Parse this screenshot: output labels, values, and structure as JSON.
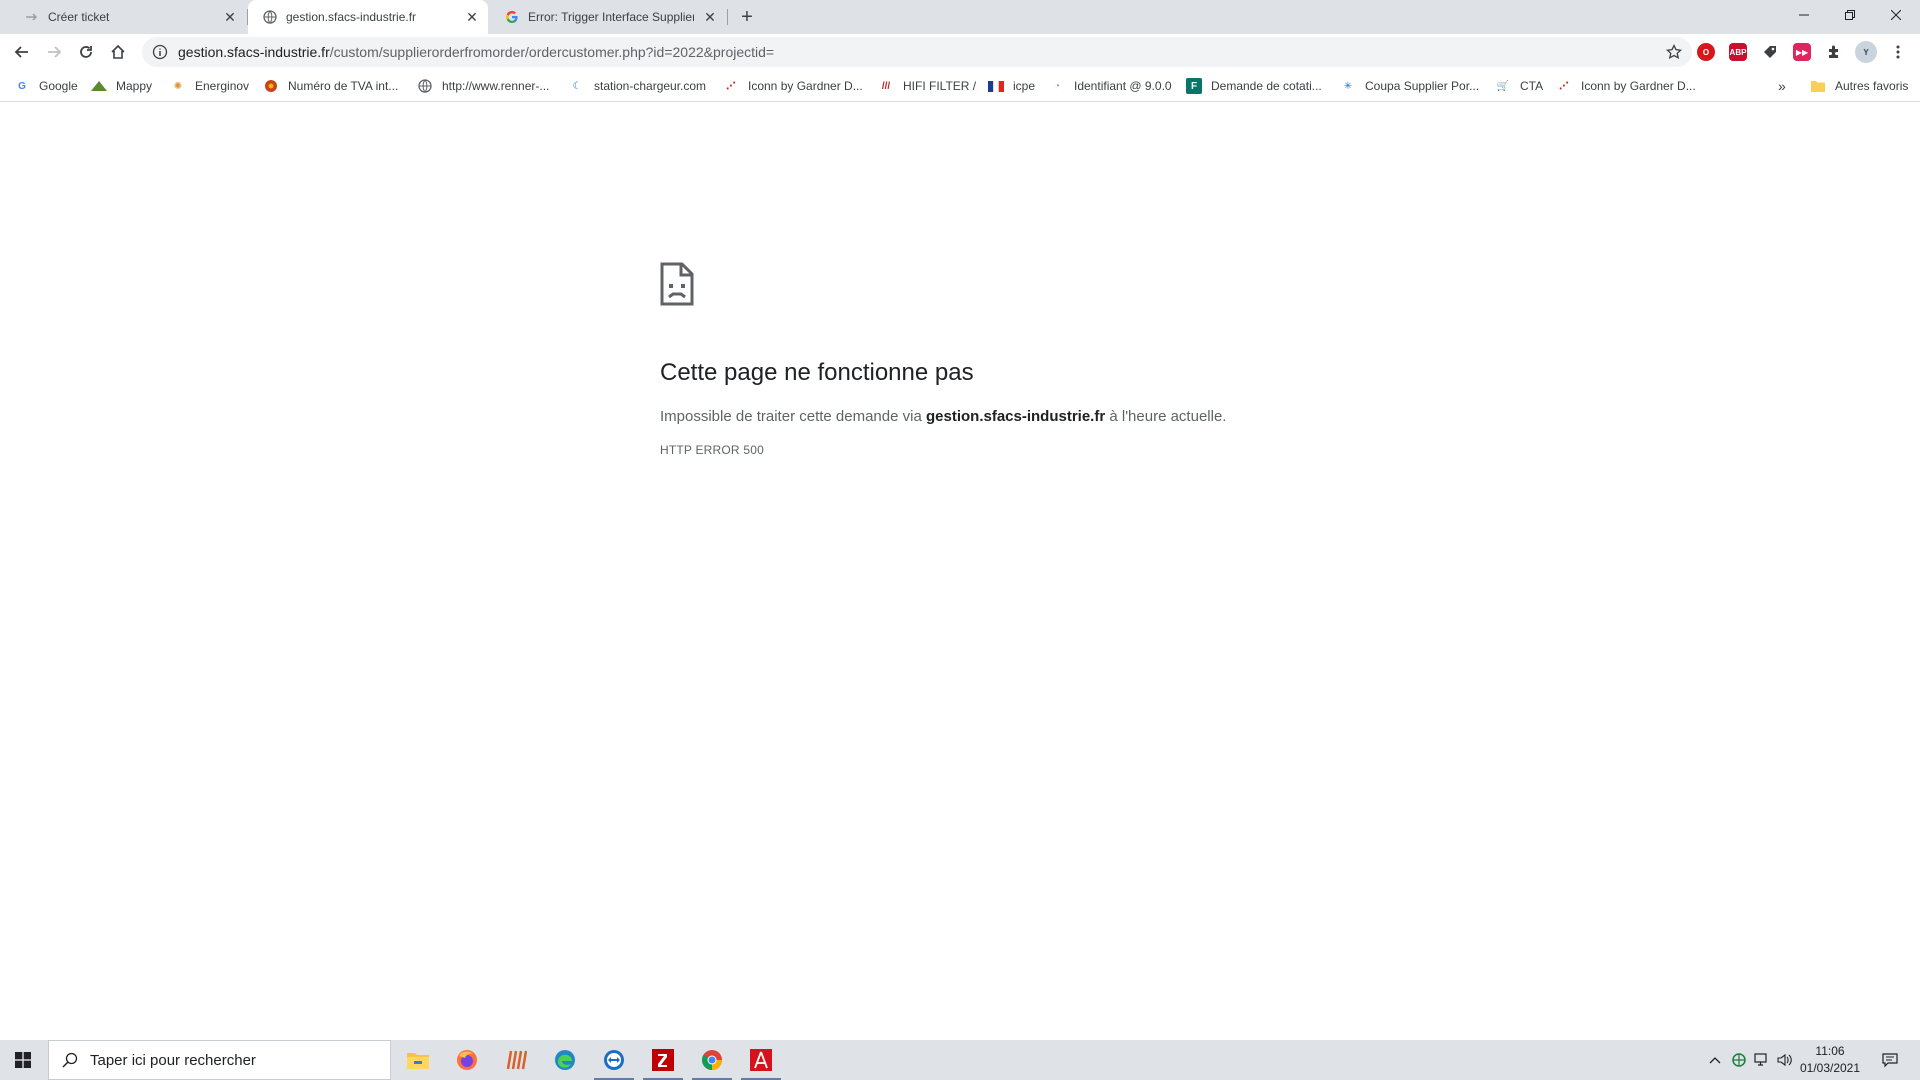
{
  "tabs": [
    {
      "title": "Créer ticket",
      "icon": "arrow-icon",
      "active": false
    },
    {
      "title": "gestion.sfacs-industrie.fr",
      "icon": "globe-icon",
      "active": true
    },
    {
      "title": "Error: Trigger Interface Supplier o",
      "icon": "google-icon",
      "active": false
    }
  ],
  "new_tab_label": "+",
  "address": {
    "host": "gestion.sfacs-industrie.fr",
    "path": "/custom/supplierorderfromorder/ordercustomer.php?id=2022&projectid="
  },
  "bookmarks": [
    {
      "label": "Google",
      "icon": "google-icon"
    },
    {
      "label": "Mappy",
      "icon": "mappy-icon"
    },
    {
      "label": "Energinov",
      "icon": "energinov-icon"
    },
    {
      "label": "Numéro de TVA int...",
      "icon": "tva-icon"
    },
    {
      "label": "http://www.renner-...",
      "icon": "globe-icon"
    },
    {
      "label": "station-chargeur.com",
      "icon": "station-icon"
    },
    {
      "label": "Iconn by Gardner D...",
      "icon": "iconn-icon"
    },
    {
      "label": "HIFI FILTER /",
      "icon": "hifi-icon"
    },
    {
      "label": "icpe",
      "icon": "flag-icon"
    },
    {
      "label": "Identifiant @ 9.0.0",
      "icon": "identifiant-icon"
    },
    {
      "label": "Demande de cotati...",
      "icon": "forms-icon"
    },
    {
      "label": "Coupa Supplier Por...",
      "icon": "coupa-icon"
    },
    {
      "label": "CTA",
      "icon": "cart-icon"
    },
    {
      "label": "Iconn by Gardner D...",
      "icon": "iconn-icon"
    }
  ],
  "bookmarks_more": "»",
  "other_bookmarks": "Autres favoris",
  "error": {
    "title": "Cette page ne fonctionne pas",
    "desc_before": "Impossible de traiter cette demande via ",
    "desc_host": "gestion.sfacs-industrie.fr",
    "desc_after": " à l'heure actuelle.",
    "code": "HTTP ERROR 500"
  },
  "taskbar": {
    "search_placeholder": "Taper ici pour rechercher",
    "apps": [
      "file-explorer-icon",
      "firefox-icon",
      "winlogbeat-icon",
      "edge-icon",
      "teamviewer-icon",
      "filezilla-icon",
      "chrome-icon",
      "acrobat-icon"
    ],
    "time": "11:06",
    "date": "01/03/2021"
  },
  "colors": {
    "tabstrip": "#dee1e6",
    "omnibox": "#f1f3f4",
    "taskbar": "#dfe3e8"
  }
}
